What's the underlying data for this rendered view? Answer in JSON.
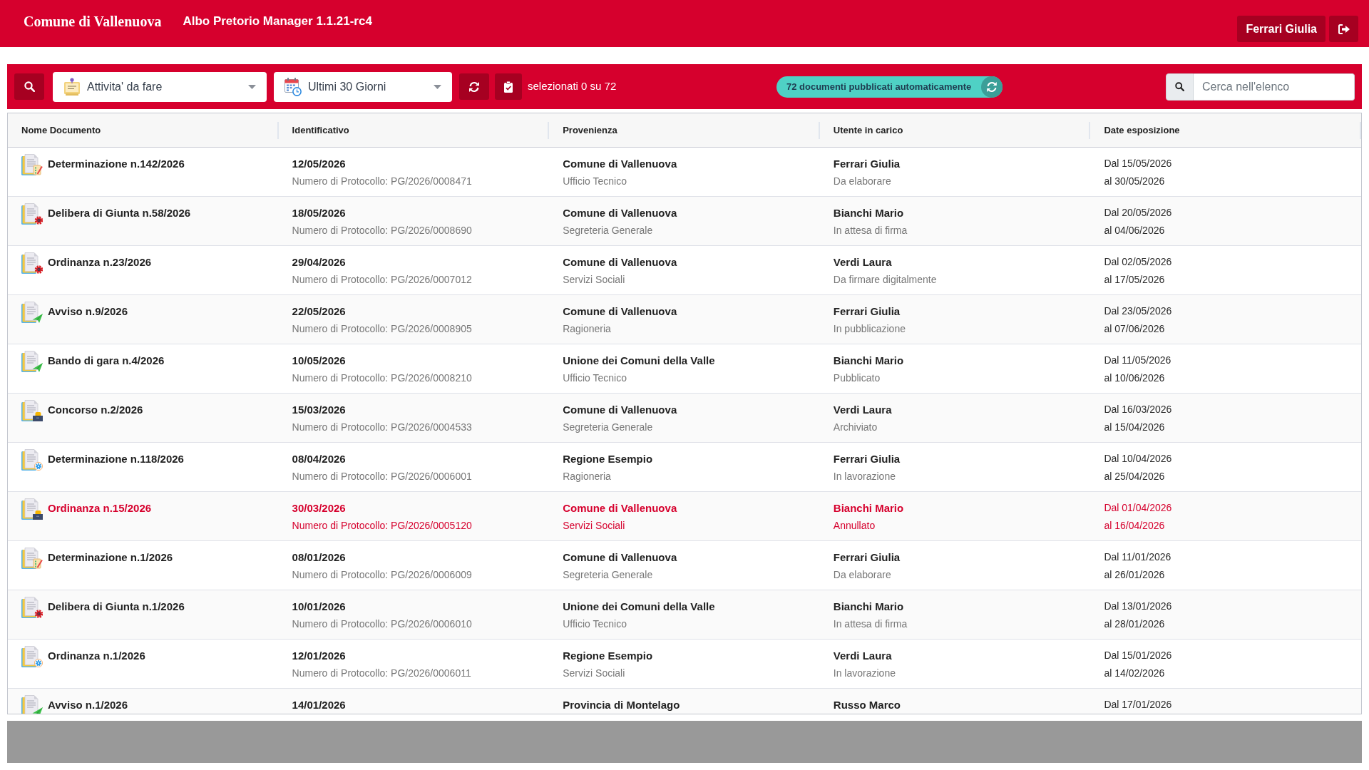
{
  "header": {
    "organization": "Comune di Vallenuova",
    "app_title": "Albo Pretorio Manager 1.1.21-rc4",
    "user": "Ferrari Giulia"
  },
  "toolbar": {
    "activity_filter": {
      "value": "Attivita' da fare"
    },
    "period_filter": {
      "value": "Ultimi 30 Giorni"
    },
    "selection": "selezionati 0 su 72",
    "auto_published": "72 documenti pubblicati automaticamente",
    "search": {
      "placeholder": "Cerca nell'elenco"
    }
  },
  "table": {
    "columns": [
      "Nome Documento",
      "Identificativo",
      "Provenienza",
      "Utente in carico",
      "Date esposizione"
    ],
    "rows": [
      {
        "kind": "draft",
        "cancelled": false,
        "name": "Determinazione n.142/2026",
        "date": "12/05/2026",
        "protocol": "Numero di Protocollo: PG/2026/0008471",
        "origin": "Comune di Vallenuova",
        "office": "Ufficio Tecnico",
        "user": "Ferrari Giulia",
        "status": "Da elaborare",
        "from": "Dal 15/05/2026",
        "to": "al 30/05/2026"
      },
      {
        "kind": "signing",
        "cancelled": false,
        "name": "Delibera di Giunta n.58/2026",
        "date": "18/05/2026",
        "protocol": "Numero di Protocollo: PG/2026/0008690",
        "origin": "Comune di Vallenuova",
        "office": "Segreteria Generale",
        "user": "Bianchi Mario",
        "status": "In attesa di firma",
        "from": "Dal 20/05/2026",
        "to": "al 04/06/2026"
      },
      {
        "kind": "signing",
        "cancelled": false,
        "name": "Ordinanza n.23/2026",
        "date": "29/04/2026",
        "protocol": "Numero di Protocollo: PG/2026/0007012",
        "origin": "Comune di Vallenuova",
        "office": "Servizi Sociali",
        "user": "Verdi Laura",
        "status": "Da firmare digitalmente",
        "from": "Dal 02/05/2026",
        "to": "al 17/05/2026"
      },
      {
        "kind": "publishing",
        "cancelled": false,
        "name": "Avviso n.9/2026",
        "date": "22/05/2026",
        "protocol": "Numero di Protocollo: PG/2026/0008905",
        "origin": "Comune di Vallenuova",
        "office": "Ragioneria",
        "user": "Ferrari Giulia",
        "status": "In pubblicazione",
        "from": "Dal 23/05/2026",
        "to": "al 07/06/2026"
      },
      {
        "kind": "publishing",
        "cancelled": false,
        "name": "Bando di gara n.4/2026",
        "date": "10/05/2026",
        "protocol": "Numero di Protocollo: PG/2026/0008210",
        "origin": "Unione dei Comuni della Valle",
        "office": "Ufficio Tecnico",
        "user": "Bianchi Mario",
        "status": "Pubblicato",
        "from": "Dal 11/05/2026",
        "to": "al 10/06/2026"
      },
      {
        "kind": "archived",
        "cancelled": false,
        "name": "Concorso n.2/2026",
        "date": "15/03/2026",
        "protocol": "Numero di Protocollo: PG/2026/0004533",
        "origin": "Comune di Vallenuova",
        "office": "Segreteria Generale",
        "user": "Verdi Laura",
        "status": "Archiviato",
        "from": "Dal 16/03/2026",
        "to": "al 15/04/2026"
      },
      {
        "kind": "processing",
        "cancelled": false,
        "name": "Determinazione n.118/2026",
        "date": "08/04/2026",
        "protocol": "Numero di Protocollo: PG/2026/0006001",
        "origin": "Regione Esempio",
        "office": "Ragioneria",
        "user": "Ferrari Giulia",
        "status": "In lavorazione",
        "from": "Dal 10/04/2026",
        "to": "al 25/04/2026"
      },
      {
        "kind": "archived",
        "cancelled": true,
        "name": "Ordinanza n.15/2026",
        "date": "30/03/2026",
        "protocol": "Numero di Protocollo: PG/2026/0005120",
        "origin": "Comune di Vallenuova",
        "office": "Servizi Sociali",
        "user": "Bianchi Mario",
        "status": "Annullato",
        "from": "Dal 01/04/2026",
        "to": "al 16/04/2026"
      },
      {
        "kind": "draft",
        "cancelled": false,
        "name": "Determinazione n.1/2026",
        "date": "08/01/2026",
        "protocol": "Numero di Protocollo: PG/2026/0006009",
        "origin": "Comune di Vallenuova",
        "office": "Segreteria Generale",
        "user": "Ferrari Giulia",
        "status": "Da elaborare",
        "from": "Dal 11/01/2026",
        "to": "al 26/01/2026"
      },
      {
        "kind": "signing",
        "cancelled": false,
        "name": "Delibera di Giunta n.1/2026",
        "date": "10/01/2026",
        "protocol": "Numero di Protocollo: PG/2026/0006010",
        "origin": "Unione dei Comuni della Valle",
        "office": "Ufficio Tecnico",
        "user": "Bianchi Mario",
        "status": "In attesa di firma",
        "from": "Dal 13/01/2026",
        "to": "al 28/01/2026"
      },
      {
        "kind": "processing",
        "cancelled": false,
        "name": "Ordinanza n.1/2026",
        "date": "12/01/2026",
        "protocol": "Numero di Protocollo: PG/2026/0006011",
        "origin": "Regione Esempio",
        "office": "Servizi Sociali",
        "user": "Verdi Laura",
        "status": "In lavorazione",
        "from": "Dal 15/01/2026",
        "to": "al 14/02/2026"
      },
      {
        "kind": "publishing",
        "cancelled": false,
        "name": "Avviso n.1/2026",
        "date": "14/01/2026",
        "origin": "Provincia di Montelago",
        "user": "Russo Marco",
        "from": "Dal 17/01/2026"
      }
    ]
  }
}
